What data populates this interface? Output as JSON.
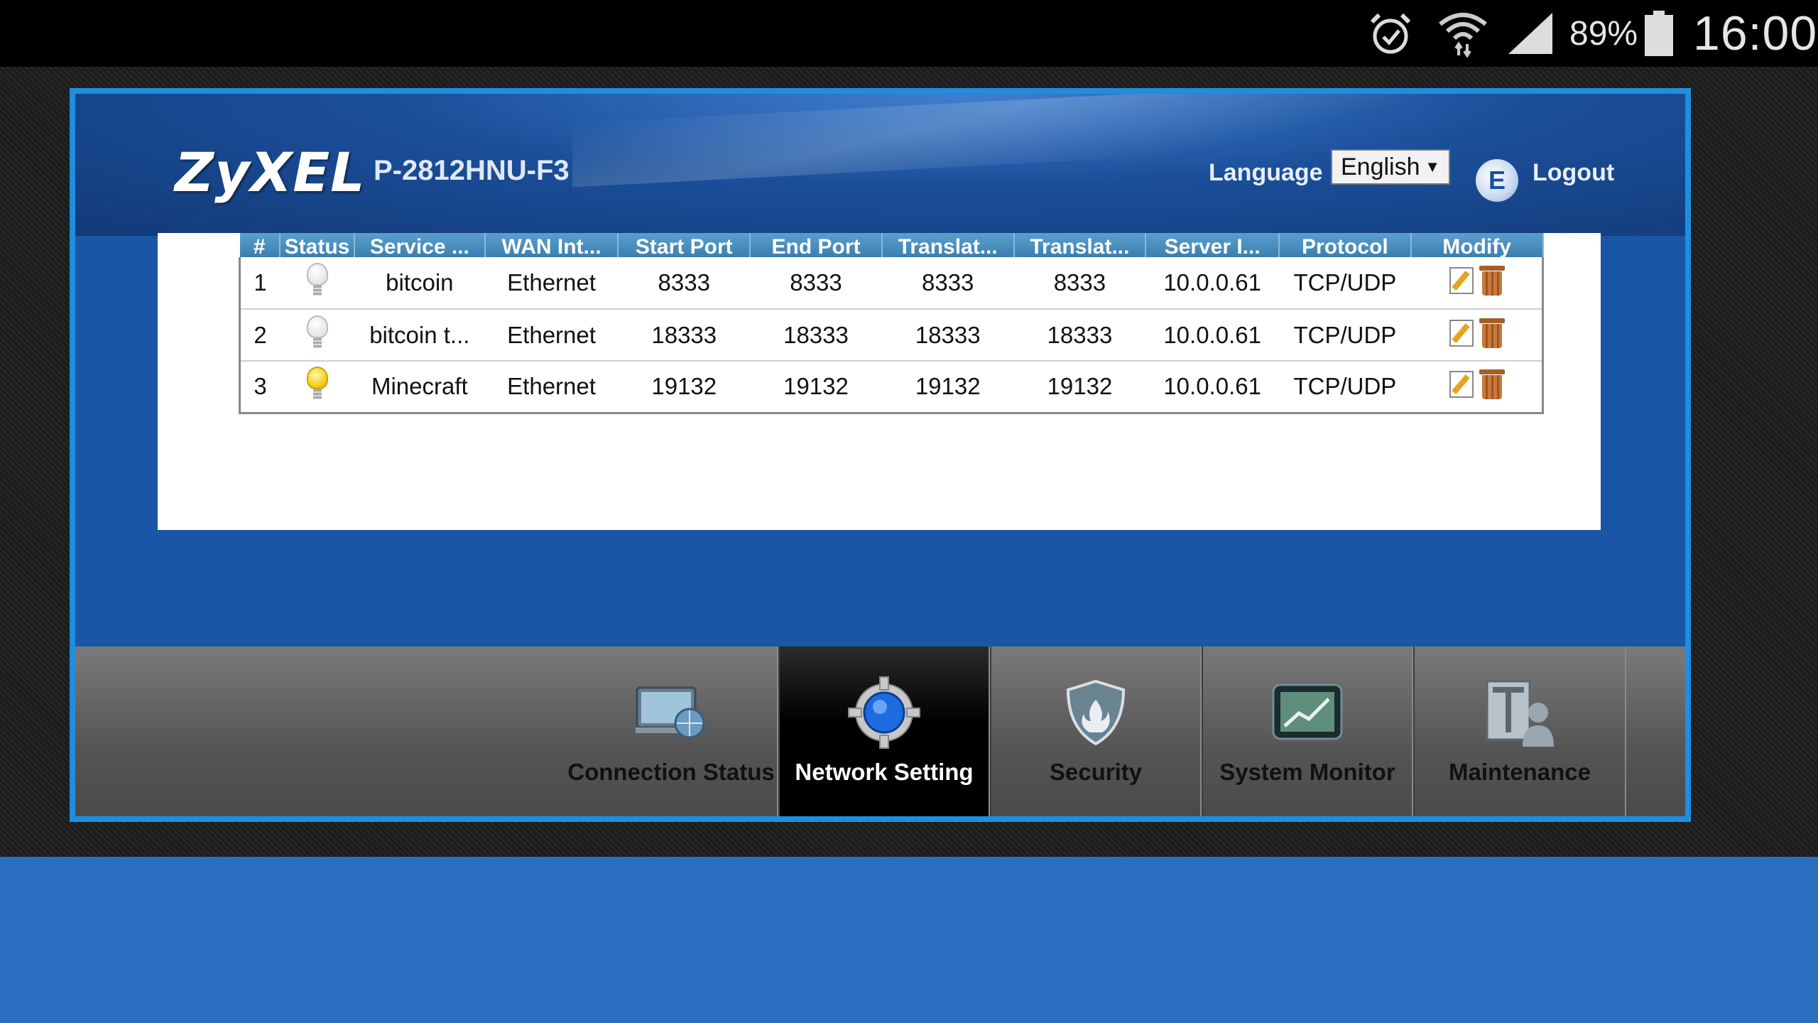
{
  "status_bar": {
    "battery_percent": "89%",
    "time": "16:00",
    "icons": [
      "alarm-icon",
      "wifi-icon",
      "signal-icon",
      "battery-icon"
    ]
  },
  "header": {
    "logo": "ZyXEL",
    "model": "P-2812HNU-F3",
    "language_label": "Language :",
    "language_value": "English",
    "logout_label": "Logout"
  },
  "table": {
    "columns": [
      "#",
      "Status",
      "Service ...",
      "WAN Int...",
      "Start Port",
      "End Port",
      "Translat...",
      "Translat...",
      "Server I...",
      "Protocol",
      "Modify"
    ],
    "rows": [
      {
        "num": "1",
        "status": "off",
        "service": "bitcoin",
        "wan": "Ethernet",
        "start": "8333",
        "end": "8333",
        "t1": "8333",
        "t2": "8333",
        "server": "10.0.0.61",
        "protocol": "TCP/UDP"
      },
      {
        "num": "2",
        "status": "off",
        "service": "bitcoin t...",
        "wan": "Ethernet",
        "start": "18333",
        "end": "18333",
        "t1": "18333",
        "t2": "18333",
        "server": "10.0.0.61",
        "protocol": "TCP/UDP"
      },
      {
        "num": "3",
        "status": "on",
        "service": "Minecraft",
        "wan": "Ethernet",
        "start": "19132",
        "end": "19132",
        "t1": "19132",
        "t2": "19132",
        "server": "10.0.0.61",
        "protocol": "TCP/UDP"
      }
    ]
  },
  "nav": {
    "items": [
      {
        "label": "Connection Status",
        "icon": "monitor-globe-icon",
        "active": false
      },
      {
        "label": "Network Setting",
        "icon": "gear-globe-icon",
        "active": true
      },
      {
        "label": "Security",
        "icon": "shield-icon",
        "active": false
      },
      {
        "label": "System Monitor",
        "icon": "chart-monitor-icon",
        "active": false
      },
      {
        "label": "Maintenance",
        "icon": "toolbox-user-icon",
        "active": false
      }
    ]
  },
  "colors": {
    "frame_border": "#1e8ee0",
    "header_blue": "#1b4f9a",
    "table_header": "#3b7fb0",
    "nav_active": "#000000",
    "bottom_panel": "#2a6ec1"
  }
}
